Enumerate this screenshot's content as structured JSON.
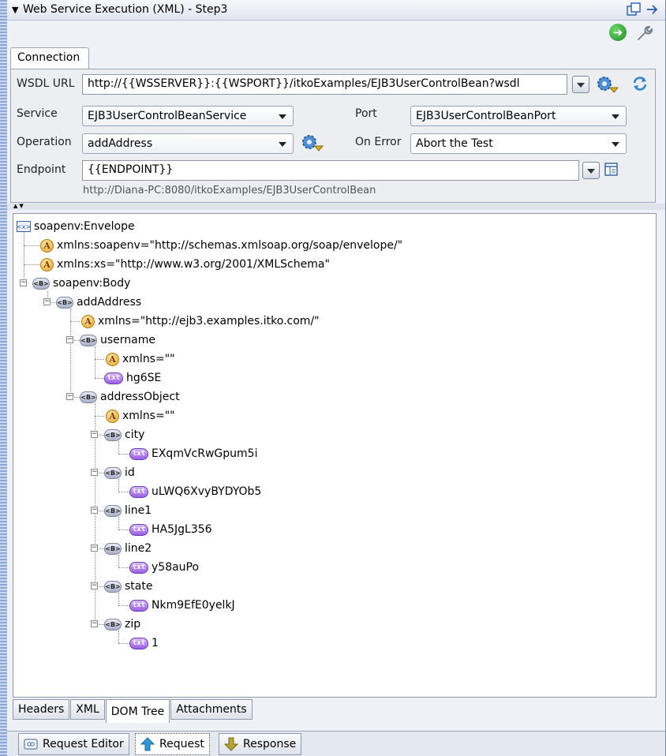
{
  "window": {
    "title": "Web Service Execution (XML) - Step3"
  },
  "connection": {
    "tab_label": "Connection",
    "wsdl_url_label": "WSDL URL",
    "wsdl_url_value": "http://{{WSSERVER}}:{{WSPORT}}/itkoExamples/EJB3UserControlBean?wsdl",
    "service_label": "Service",
    "service_value": "EJB3UserControlBeanService",
    "port_label": "Port",
    "port_value": "EJB3UserControlBeanPort",
    "operation_label": "Operation",
    "operation_value": "addAddress",
    "on_error_label": "On Error",
    "on_error_value": "Abort the Test",
    "endpoint_label": "Endpoint",
    "endpoint_value": "{{ENDPOINT}}",
    "endpoint_resolved": "http://Diana-PC:8080/itkoExamples/EJB3UserControlBean"
  },
  "tree": {
    "nodes": [
      {
        "kind": "root",
        "text": "soapenv:Envelope"
      },
      {
        "kind": "attr",
        "text": "xmlns:soapenv=\"http://schemas.xmlsoap.org/soap/envelope/\""
      },
      {
        "kind": "attr",
        "text": "xmlns:xs=\"http://www.w3.org/2001/XMLSchema\""
      },
      {
        "kind": "elem",
        "text": "soapenv:Body"
      },
      {
        "kind": "elem",
        "text": "addAddress"
      },
      {
        "kind": "attr",
        "text": "xmlns=\"http://ejb3.examples.itko.com/\""
      },
      {
        "kind": "elem",
        "text": "username"
      },
      {
        "kind": "attr",
        "text": "xmlns=\"\""
      },
      {
        "kind": "text",
        "text": "hg6SE"
      },
      {
        "kind": "elem",
        "text": "addressObject"
      },
      {
        "kind": "attr",
        "text": "xmlns=\"\""
      },
      {
        "kind": "elem",
        "text": "city"
      },
      {
        "kind": "text",
        "text": "EXqmVcRwGpum5i"
      },
      {
        "kind": "elem",
        "text": "id"
      },
      {
        "kind": "text",
        "text": "uLWQ6XvyBYDYOb5"
      },
      {
        "kind": "elem",
        "text": "line1"
      },
      {
        "kind": "text",
        "text": "HA5JgL356"
      },
      {
        "kind": "elem",
        "text": "line2"
      },
      {
        "kind": "text",
        "text": "y58auPo"
      },
      {
        "kind": "elem",
        "text": "state"
      },
      {
        "kind": "text",
        "text": "Nkm9EfE0yelkJ"
      },
      {
        "kind": "elem",
        "text": "zip"
      },
      {
        "kind": "text",
        "text": "1"
      }
    ]
  },
  "sub_tabs": [
    "Headers",
    "XML",
    "DOM Tree",
    "Attachments"
  ],
  "bottom_tabs": [
    "Request Editor",
    "Request",
    "Response"
  ],
  "icons": {
    "collapse": "triangle-down-icon",
    "elem_badge": "<B>",
    "attr_badge": "A",
    "text_badge": "txt",
    "root_badge": "<x>"
  }
}
